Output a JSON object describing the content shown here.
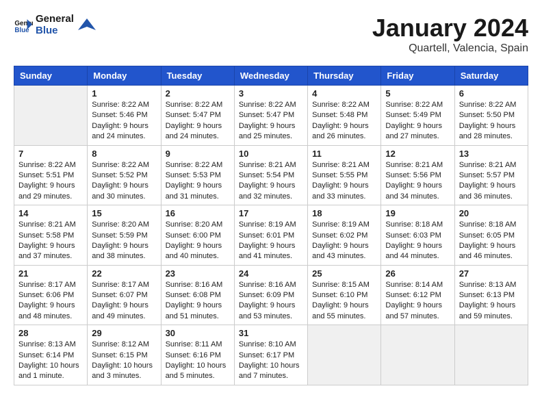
{
  "header": {
    "logo_text_general": "General",
    "logo_text_blue": "Blue",
    "month_title": "January 2024",
    "location": "Quartell, Valencia, Spain"
  },
  "days_of_week": [
    "Sunday",
    "Monday",
    "Tuesday",
    "Wednesday",
    "Thursday",
    "Friday",
    "Saturday"
  ],
  "weeks": [
    [
      {
        "day": "",
        "sunrise": "",
        "sunset": "",
        "daylight": "",
        "empty": true
      },
      {
        "day": "1",
        "sunrise": "Sunrise: 8:22 AM",
        "sunset": "Sunset: 5:46 PM",
        "daylight": "Daylight: 9 hours and 24 minutes."
      },
      {
        "day": "2",
        "sunrise": "Sunrise: 8:22 AM",
        "sunset": "Sunset: 5:47 PM",
        "daylight": "Daylight: 9 hours and 24 minutes."
      },
      {
        "day": "3",
        "sunrise": "Sunrise: 8:22 AM",
        "sunset": "Sunset: 5:47 PM",
        "daylight": "Daylight: 9 hours and 25 minutes."
      },
      {
        "day": "4",
        "sunrise": "Sunrise: 8:22 AM",
        "sunset": "Sunset: 5:48 PM",
        "daylight": "Daylight: 9 hours and 26 minutes."
      },
      {
        "day": "5",
        "sunrise": "Sunrise: 8:22 AM",
        "sunset": "Sunset: 5:49 PM",
        "daylight": "Daylight: 9 hours and 27 minutes."
      },
      {
        "day": "6",
        "sunrise": "Sunrise: 8:22 AM",
        "sunset": "Sunset: 5:50 PM",
        "daylight": "Daylight: 9 hours and 28 minutes."
      }
    ],
    [
      {
        "day": "7",
        "sunrise": "Sunrise: 8:22 AM",
        "sunset": "Sunset: 5:51 PM",
        "daylight": "Daylight: 9 hours and 29 minutes."
      },
      {
        "day": "8",
        "sunrise": "Sunrise: 8:22 AM",
        "sunset": "Sunset: 5:52 PM",
        "daylight": "Daylight: 9 hours and 30 minutes."
      },
      {
        "day": "9",
        "sunrise": "Sunrise: 8:22 AM",
        "sunset": "Sunset: 5:53 PM",
        "daylight": "Daylight: 9 hours and 31 minutes."
      },
      {
        "day": "10",
        "sunrise": "Sunrise: 8:21 AM",
        "sunset": "Sunset: 5:54 PM",
        "daylight": "Daylight: 9 hours and 32 minutes."
      },
      {
        "day": "11",
        "sunrise": "Sunrise: 8:21 AM",
        "sunset": "Sunset: 5:55 PM",
        "daylight": "Daylight: 9 hours and 33 minutes."
      },
      {
        "day": "12",
        "sunrise": "Sunrise: 8:21 AM",
        "sunset": "Sunset: 5:56 PM",
        "daylight": "Daylight: 9 hours and 34 minutes."
      },
      {
        "day": "13",
        "sunrise": "Sunrise: 8:21 AM",
        "sunset": "Sunset: 5:57 PM",
        "daylight": "Daylight: 9 hours and 36 minutes."
      }
    ],
    [
      {
        "day": "14",
        "sunrise": "Sunrise: 8:21 AM",
        "sunset": "Sunset: 5:58 PM",
        "daylight": "Daylight: 9 hours and 37 minutes."
      },
      {
        "day": "15",
        "sunrise": "Sunrise: 8:20 AM",
        "sunset": "Sunset: 5:59 PM",
        "daylight": "Daylight: 9 hours and 38 minutes."
      },
      {
        "day": "16",
        "sunrise": "Sunrise: 8:20 AM",
        "sunset": "Sunset: 6:00 PM",
        "daylight": "Daylight: 9 hours and 40 minutes."
      },
      {
        "day": "17",
        "sunrise": "Sunrise: 8:19 AM",
        "sunset": "Sunset: 6:01 PM",
        "daylight": "Daylight: 9 hours and 41 minutes."
      },
      {
        "day": "18",
        "sunrise": "Sunrise: 8:19 AM",
        "sunset": "Sunset: 6:02 PM",
        "daylight": "Daylight: 9 hours and 43 minutes."
      },
      {
        "day": "19",
        "sunrise": "Sunrise: 8:18 AM",
        "sunset": "Sunset: 6:03 PM",
        "daylight": "Daylight: 9 hours and 44 minutes."
      },
      {
        "day": "20",
        "sunrise": "Sunrise: 8:18 AM",
        "sunset": "Sunset: 6:05 PM",
        "daylight": "Daylight: 9 hours and 46 minutes."
      }
    ],
    [
      {
        "day": "21",
        "sunrise": "Sunrise: 8:17 AM",
        "sunset": "Sunset: 6:06 PM",
        "daylight": "Daylight: 9 hours and 48 minutes."
      },
      {
        "day": "22",
        "sunrise": "Sunrise: 8:17 AM",
        "sunset": "Sunset: 6:07 PM",
        "daylight": "Daylight: 9 hours and 49 minutes."
      },
      {
        "day": "23",
        "sunrise": "Sunrise: 8:16 AM",
        "sunset": "Sunset: 6:08 PM",
        "daylight": "Daylight: 9 hours and 51 minutes."
      },
      {
        "day": "24",
        "sunrise": "Sunrise: 8:16 AM",
        "sunset": "Sunset: 6:09 PM",
        "daylight": "Daylight: 9 hours and 53 minutes."
      },
      {
        "day": "25",
        "sunrise": "Sunrise: 8:15 AM",
        "sunset": "Sunset: 6:10 PM",
        "daylight": "Daylight: 9 hours and 55 minutes."
      },
      {
        "day": "26",
        "sunrise": "Sunrise: 8:14 AM",
        "sunset": "Sunset: 6:12 PM",
        "daylight": "Daylight: 9 hours and 57 minutes."
      },
      {
        "day": "27",
        "sunrise": "Sunrise: 8:13 AM",
        "sunset": "Sunset: 6:13 PM",
        "daylight": "Daylight: 9 hours and 59 minutes."
      }
    ],
    [
      {
        "day": "28",
        "sunrise": "Sunrise: 8:13 AM",
        "sunset": "Sunset: 6:14 PM",
        "daylight": "Daylight: 10 hours and 1 minute."
      },
      {
        "day": "29",
        "sunrise": "Sunrise: 8:12 AM",
        "sunset": "Sunset: 6:15 PM",
        "daylight": "Daylight: 10 hours and 3 minutes."
      },
      {
        "day": "30",
        "sunrise": "Sunrise: 8:11 AM",
        "sunset": "Sunset: 6:16 PM",
        "daylight": "Daylight: 10 hours and 5 minutes."
      },
      {
        "day": "31",
        "sunrise": "Sunrise: 8:10 AM",
        "sunset": "Sunset: 6:17 PM",
        "daylight": "Daylight: 10 hours and 7 minutes."
      },
      {
        "day": "",
        "sunrise": "",
        "sunset": "",
        "daylight": "",
        "empty": true
      },
      {
        "day": "",
        "sunrise": "",
        "sunset": "",
        "daylight": "",
        "empty": true
      },
      {
        "day": "",
        "sunrise": "",
        "sunset": "",
        "daylight": "",
        "empty": true
      }
    ]
  ]
}
